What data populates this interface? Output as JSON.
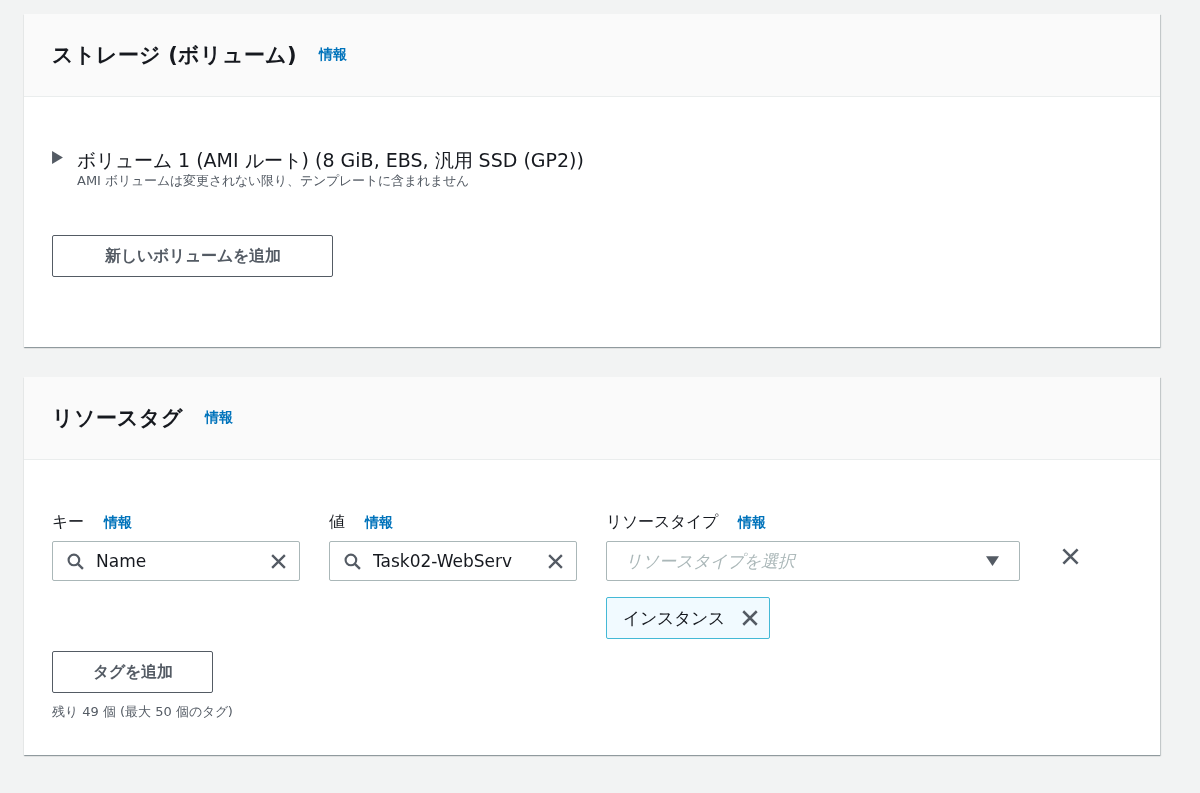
{
  "storage": {
    "title": "ストレージ (ボリューム)",
    "info": "情報",
    "volumes": [
      {
        "title": "ボリューム 1 (AMI ルート) (8 GiB, EBS, 汎用 SSD (GP2))",
        "description": "AMI ボリュームは変更されない限り、テンプレートに含まれません",
        "expanded": false
      }
    ],
    "add_button": "新しいボリュームを追加"
  },
  "tags": {
    "title": "リソースタグ",
    "info": "情報",
    "columns": [
      {
        "label": "キー",
        "info": "情報"
      },
      {
        "label": "値",
        "info": "情報"
      },
      {
        "label": "リソースタイプ",
        "info": "情報"
      }
    ],
    "rows": [
      {
        "key": "Name",
        "value": "Task02-WebServ",
        "resource_type": {
          "placeholder": "リソースタイプを選択"
        },
        "chips": [
          "インスタンス"
        ]
      }
    ],
    "add_button": "タグを追加",
    "hint": "残り 49 個 (最大 50 個のタグ)"
  }
}
